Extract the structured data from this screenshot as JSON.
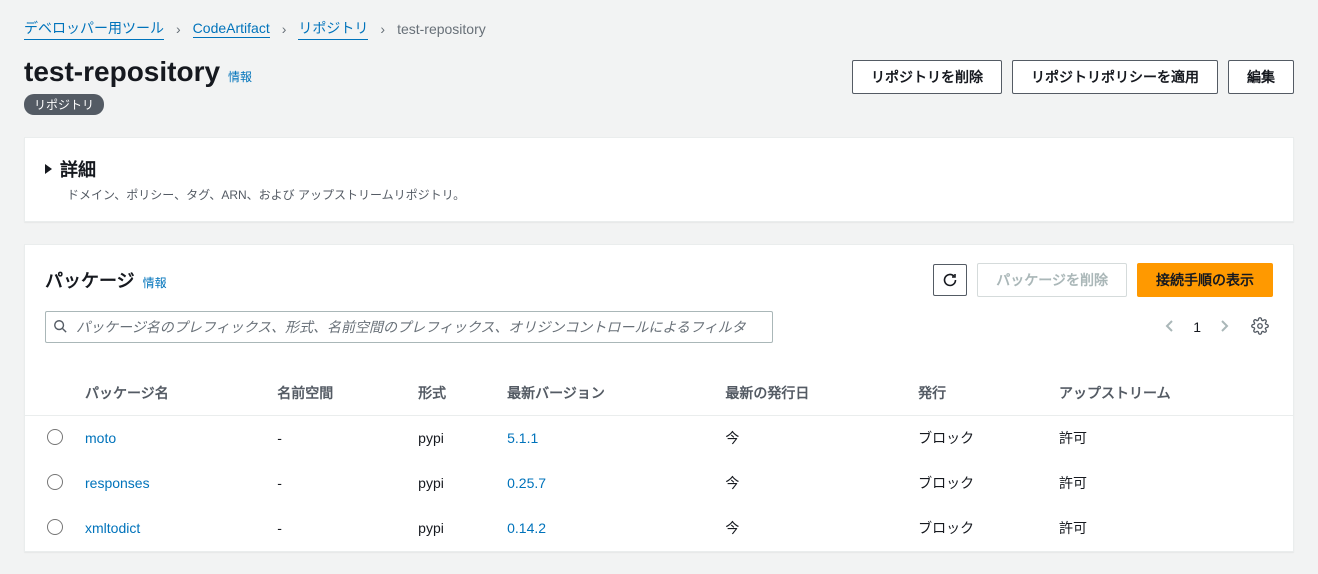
{
  "breadcrumb": {
    "items": [
      {
        "label": "デベロッパー用ツール",
        "link": true
      },
      {
        "label": "CodeArtifact",
        "link": true
      },
      {
        "label": "リポジトリ",
        "link": true
      },
      {
        "label": "test-repository",
        "link": false
      }
    ]
  },
  "header": {
    "title": "test-repository",
    "info": "情報",
    "badge": "リポジトリ",
    "actions": {
      "delete": "リポジトリを削除",
      "apply_policy": "リポジトリポリシーを適用",
      "edit": "編集"
    }
  },
  "details": {
    "title": "詳細",
    "subtitle": "ドメイン、ポリシー、タグ、ARN、および アップストリームリポジトリ。"
  },
  "packages": {
    "title": "パッケージ",
    "info": "情報",
    "actions": {
      "delete": "パッケージを削除",
      "connect": "接続手順の表示"
    },
    "search_placeholder": "パッケージ名のプレフィックス、形式、名前空間のプレフィックス、オリジンコントロールによるフィルタ",
    "page": "1",
    "columns": {
      "name": "パッケージ名",
      "namespace": "名前空間",
      "format": "形式",
      "latest_version": "最新バージョン",
      "latest_publish": "最新の発行日",
      "publish": "発行",
      "upstream": "アップストリーム"
    },
    "rows": [
      {
        "name": "moto",
        "namespace": "-",
        "format": "pypi",
        "version": "5.1.1",
        "published": "今",
        "publish": "ブロック",
        "upstream": "許可"
      },
      {
        "name": "responses",
        "namespace": "-",
        "format": "pypi",
        "version": "0.25.7",
        "published": "今",
        "publish": "ブロック",
        "upstream": "許可"
      },
      {
        "name": "xmltodict",
        "namespace": "-",
        "format": "pypi",
        "version": "0.14.2",
        "published": "今",
        "publish": "ブロック",
        "upstream": "許可"
      }
    ]
  }
}
